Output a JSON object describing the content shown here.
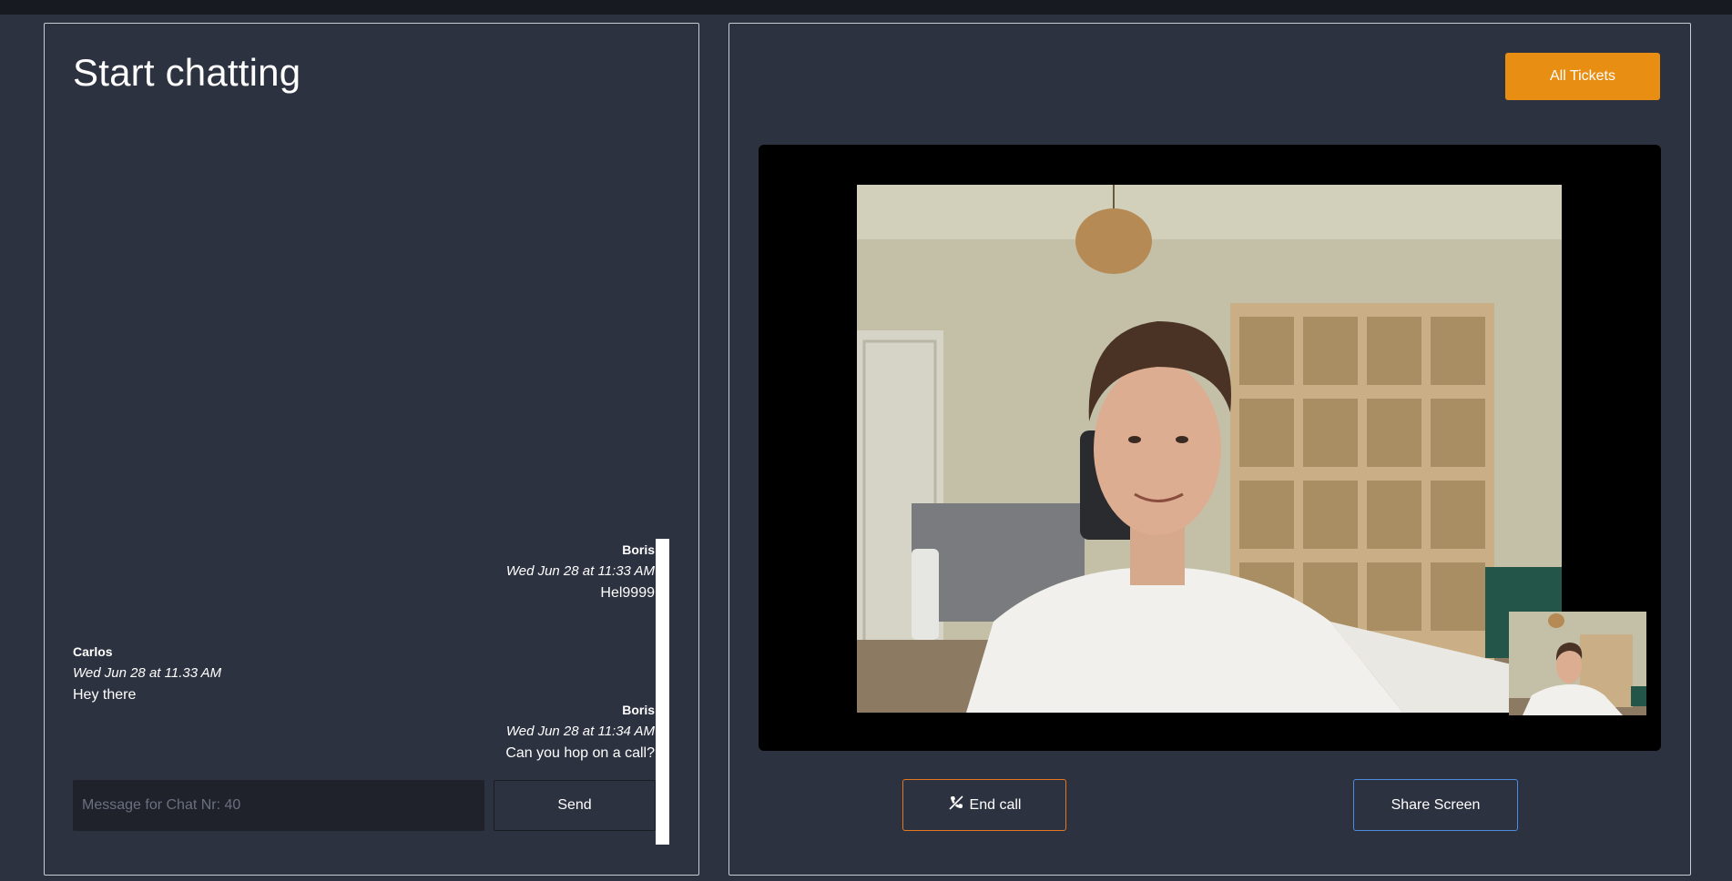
{
  "chat": {
    "title": "Start chatting",
    "messages": [
      {
        "author": "Boris",
        "time": "Wed Jun 28 at 11:33 AM",
        "text": "Hel9999",
        "align": "right"
      },
      {
        "author": "Carlos",
        "time": "Wed Jun 28 at 11.33 AM",
        "text": "Hey there",
        "align": "left"
      },
      {
        "author": "Boris",
        "time": "Wed Jun 28 at 11:34 AM",
        "text": "Can you hop on a call?",
        "align": "right"
      }
    ],
    "input_placeholder": "Message for Chat Nr: 40",
    "input_value": "",
    "send_label": "Send"
  },
  "video": {
    "tickets_label": "All Tickets",
    "end_call_label": "End call",
    "end_call_icon": "phone-slash-icon",
    "share_screen_label": "Share Screen"
  },
  "colors": {
    "background": "#2d3240",
    "tickets_button": "#e88e12",
    "end_call_border": "#e4771f",
    "share_screen_border": "#4a8de0"
  }
}
